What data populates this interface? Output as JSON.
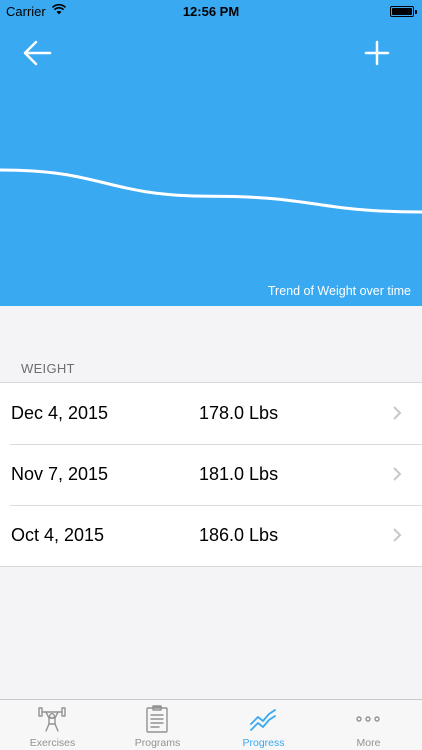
{
  "status_bar": {
    "carrier": "Carrier",
    "time": "12:56 PM"
  },
  "nav": {
    "back_icon": "arrow-left-icon",
    "add_icon": "plus-icon"
  },
  "chart": {
    "caption": "Trend of Weight over time",
    "line_color": "#ffffff",
    "background": "#39a9f2"
  },
  "chart_data": {
    "type": "line",
    "title": "Trend of Weight over time",
    "x": [
      "Oct 4, 2015",
      "Nov 7, 2015",
      "Dec 4, 2015"
    ],
    "values": [
      186.0,
      181.0,
      178.0
    ],
    "grid": false
  },
  "section": {
    "header": "WEIGHT"
  },
  "entries": [
    {
      "date": "Dec 4, 2015",
      "value": "178.0 Lbs"
    },
    {
      "date": "Nov 7, 2015",
      "value": "181.0 Lbs"
    },
    {
      "date": "Oct 4, 2015",
      "value": "186.0 Lbs"
    }
  ],
  "tabs": [
    {
      "label": "Exercises",
      "icon": "weightlifter-icon",
      "active": false
    },
    {
      "label": "Programs",
      "icon": "clipboard-icon",
      "active": false
    },
    {
      "label": "Progress",
      "icon": "trend-line-icon",
      "active": true
    },
    {
      "label": "More",
      "icon": "more-dots-icon",
      "active": false
    }
  ],
  "colors": {
    "accent": "#39a9f2",
    "inactive_tab": "#929292"
  }
}
